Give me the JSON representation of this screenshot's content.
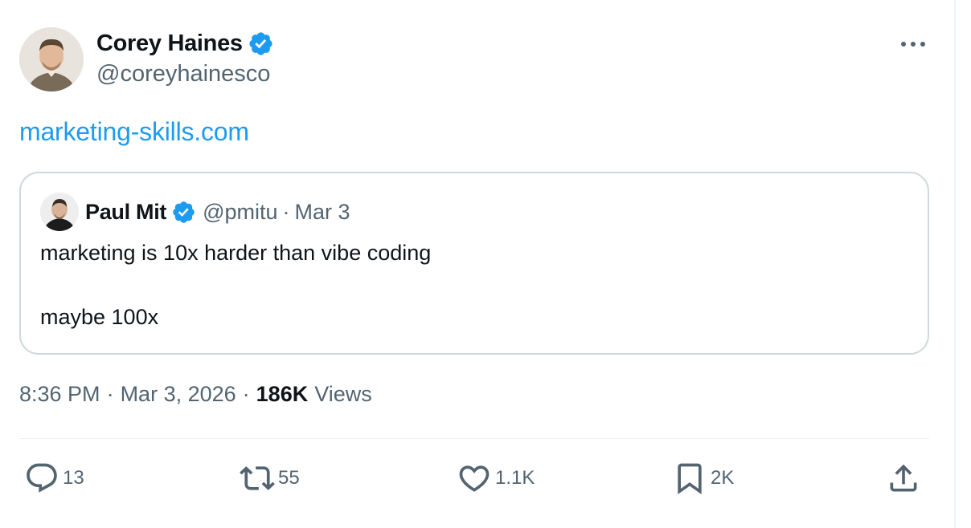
{
  "author": {
    "name": "Corey Haines",
    "handle": "@coreyhainesco"
  },
  "tweet": {
    "link_text": "marketing-skills.com"
  },
  "quoted": {
    "name": "Paul Mit",
    "handle": "@pmitu",
    "separator": "·",
    "date": "Mar 3",
    "line1": "marketing is 10x harder than vibe coding",
    "line2": "maybe 100x"
  },
  "meta": {
    "time": "8:36 PM",
    "sep1": "·",
    "date": "Mar 3, 2026",
    "sep2": "·",
    "views_count": "186K",
    "views_label": "Views"
  },
  "actions": {
    "reply_count": "13",
    "retweet_count": "55",
    "like_count": "1.1K",
    "bookmark_count": "2K"
  },
  "colors": {
    "accent": "#1d9bf0",
    "text": "#0f1419",
    "muted": "#536471",
    "border": "#cfd9de",
    "verified": "#1d9bf0"
  },
  "icons": [
    "verified-badge-icon",
    "more-icon",
    "reply-icon",
    "retweet-icon",
    "like-icon",
    "bookmark-icon",
    "share-icon"
  ]
}
